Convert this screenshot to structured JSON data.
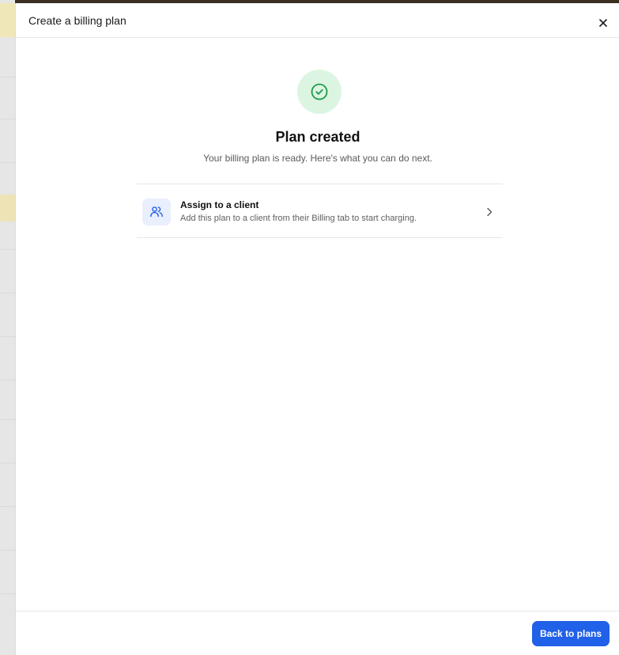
{
  "modal": {
    "title": "Create a billing plan",
    "close_icon": "close-icon"
  },
  "success": {
    "icon": "check-circle-icon",
    "title": "Plan created",
    "subtitle": "Your billing plan is ready. Here's what you can do next."
  },
  "actions": [
    {
      "icon": "users-icon",
      "title": "Assign to a client",
      "description": "Add this plan to a client from their Billing tab to start charging.",
      "chevron_icon": "chevron-right-icon"
    }
  ],
  "footer": {
    "primary_label": "Back to plans"
  },
  "colors": {
    "accent": "#2160e8",
    "success_bg": "#dcf5e2",
    "success_fg": "#1f9a4a",
    "action_icon_bg": "#e9effd"
  }
}
